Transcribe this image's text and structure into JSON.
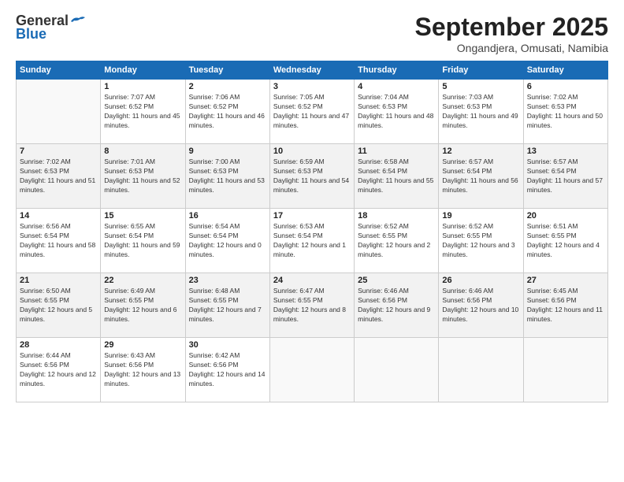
{
  "header": {
    "logo_general": "General",
    "logo_blue": "Blue",
    "month_title": "September 2025",
    "subtitle": "Ongandjera, Omusati, Namibia"
  },
  "weekdays": [
    "Sunday",
    "Monday",
    "Tuesday",
    "Wednesday",
    "Thursday",
    "Friday",
    "Saturday"
  ],
  "weeks": [
    [
      {
        "day": "",
        "sunrise": "",
        "sunset": "",
        "daylight": ""
      },
      {
        "day": "1",
        "sunrise": "Sunrise: 7:07 AM",
        "sunset": "Sunset: 6:52 PM",
        "daylight": "Daylight: 11 hours and 45 minutes."
      },
      {
        "day": "2",
        "sunrise": "Sunrise: 7:06 AM",
        "sunset": "Sunset: 6:52 PM",
        "daylight": "Daylight: 11 hours and 46 minutes."
      },
      {
        "day": "3",
        "sunrise": "Sunrise: 7:05 AM",
        "sunset": "Sunset: 6:52 PM",
        "daylight": "Daylight: 11 hours and 47 minutes."
      },
      {
        "day": "4",
        "sunrise": "Sunrise: 7:04 AM",
        "sunset": "Sunset: 6:53 PM",
        "daylight": "Daylight: 11 hours and 48 minutes."
      },
      {
        "day": "5",
        "sunrise": "Sunrise: 7:03 AM",
        "sunset": "Sunset: 6:53 PM",
        "daylight": "Daylight: 11 hours and 49 minutes."
      },
      {
        "day": "6",
        "sunrise": "Sunrise: 7:02 AM",
        "sunset": "Sunset: 6:53 PM",
        "daylight": "Daylight: 11 hours and 50 minutes."
      }
    ],
    [
      {
        "day": "7",
        "sunrise": "Sunrise: 7:02 AM",
        "sunset": "Sunset: 6:53 PM",
        "daylight": "Daylight: 11 hours and 51 minutes."
      },
      {
        "day": "8",
        "sunrise": "Sunrise: 7:01 AM",
        "sunset": "Sunset: 6:53 PM",
        "daylight": "Daylight: 11 hours and 52 minutes."
      },
      {
        "day": "9",
        "sunrise": "Sunrise: 7:00 AM",
        "sunset": "Sunset: 6:53 PM",
        "daylight": "Daylight: 11 hours and 53 minutes."
      },
      {
        "day": "10",
        "sunrise": "Sunrise: 6:59 AM",
        "sunset": "Sunset: 6:53 PM",
        "daylight": "Daylight: 11 hours and 54 minutes."
      },
      {
        "day": "11",
        "sunrise": "Sunrise: 6:58 AM",
        "sunset": "Sunset: 6:54 PM",
        "daylight": "Daylight: 11 hours and 55 minutes."
      },
      {
        "day": "12",
        "sunrise": "Sunrise: 6:57 AM",
        "sunset": "Sunset: 6:54 PM",
        "daylight": "Daylight: 11 hours and 56 minutes."
      },
      {
        "day": "13",
        "sunrise": "Sunrise: 6:57 AM",
        "sunset": "Sunset: 6:54 PM",
        "daylight": "Daylight: 11 hours and 57 minutes."
      }
    ],
    [
      {
        "day": "14",
        "sunrise": "Sunrise: 6:56 AM",
        "sunset": "Sunset: 6:54 PM",
        "daylight": "Daylight: 11 hours and 58 minutes."
      },
      {
        "day": "15",
        "sunrise": "Sunrise: 6:55 AM",
        "sunset": "Sunset: 6:54 PM",
        "daylight": "Daylight: 11 hours and 59 minutes."
      },
      {
        "day": "16",
        "sunrise": "Sunrise: 6:54 AM",
        "sunset": "Sunset: 6:54 PM",
        "daylight": "Daylight: 12 hours and 0 minutes."
      },
      {
        "day": "17",
        "sunrise": "Sunrise: 6:53 AM",
        "sunset": "Sunset: 6:54 PM",
        "daylight": "Daylight: 12 hours and 1 minute."
      },
      {
        "day": "18",
        "sunrise": "Sunrise: 6:52 AM",
        "sunset": "Sunset: 6:55 PM",
        "daylight": "Daylight: 12 hours and 2 minutes."
      },
      {
        "day": "19",
        "sunrise": "Sunrise: 6:52 AM",
        "sunset": "Sunset: 6:55 PM",
        "daylight": "Daylight: 12 hours and 3 minutes."
      },
      {
        "day": "20",
        "sunrise": "Sunrise: 6:51 AM",
        "sunset": "Sunset: 6:55 PM",
        "daylight": "Daylight: 12 hours and 4 minutes."
      }
    ],
    [
      {
        "day": "21",
        "sunrise": "Sunrise: 6:50 AM",
        "sunset": "Sunset: 6:55 PM",
        "daylight": "Daylight: 12 hours and 5 minutes."
      },
      {
        "day": "22",
        "sunrise": "Sunrise: 6:49 AM",
        "sunset": "Sunset: 6:55 PM",
        "daylight": "Daylight: 12 hours and 6 minutes."
      },
      {
        "day": "23",
        "sunrise": "Sunrise: 6:48 AM",
        "sunset": "Sunset: 6:55 PM",
        "daylight": "Daylight: 12 hours and 7 minutes."
      },
      {
        "day": "24",
        "sunrise": "Sunrise: 6:47 AM",
        "sunset": "Sunset: 6:55 PM",
        "daylight": "Daylight: 12 hours and 8 minutes."
      },
      {
        "day": "25",
        "sunrise": "Sunrise: 6:46 AM",
        "sunset": "Sunset: 6:56 PM",
        "daylight": "Daylight: 12 hours and 9 minutes."
      },
      {
        "day": "26",
        "sunrise": "Sunrise: 6:46 AM",
        "sunset": "Sunset: 6:56 PM",
        "daylight": "Daylight: 12 hours and 10 minutes."
      },
      {
        "day": "27",
        "sunrise": "Sunrise: 6:45 AM",
        "sunset": "Sunset: 6:56 PM",
        "daylight": "Daylight: 12 hours and 11 minutes."
      }
    ],
    [
      {
        "day": "28",
        "sunrise": "Sunrise: 6:44 AM",
        "sunset": "Sunset: 6:56 PM",
        "daylight": "Daylight: 12 hours and 12 minutes."
      },
      {
        "day": "29",
        "sunrise": "Sunrise: 6:43 AM",
        "sunset": "Sunset: 6:56 PM",
        "daylight": "Daylight: 12 hours and 13 minutes."
      },
      {
        "day": "30",
        "sunrise": "Sunrise: 6:42 AM",
        "sunset": "Sunset: 6:56 PM",
        "daylight": "Daylight: 12 hours and 14 minutes."
      },
      {
        "day": "",
        "sunrise": "",
        "sunset": "",
        "daylight": ""
      },
      {
        "day": "",
        "sunrise": "",
        "sunset": "",
        "daylight": ""
      },
      {
        "day": "",
        "sunrise": "",
        "sunset": "",
        "daylight": ""
      },
      {
        "day": "",
        "sunrise": "",
        "sunset": "",
        "daylight": ""
      }
    ]
  ]
}
